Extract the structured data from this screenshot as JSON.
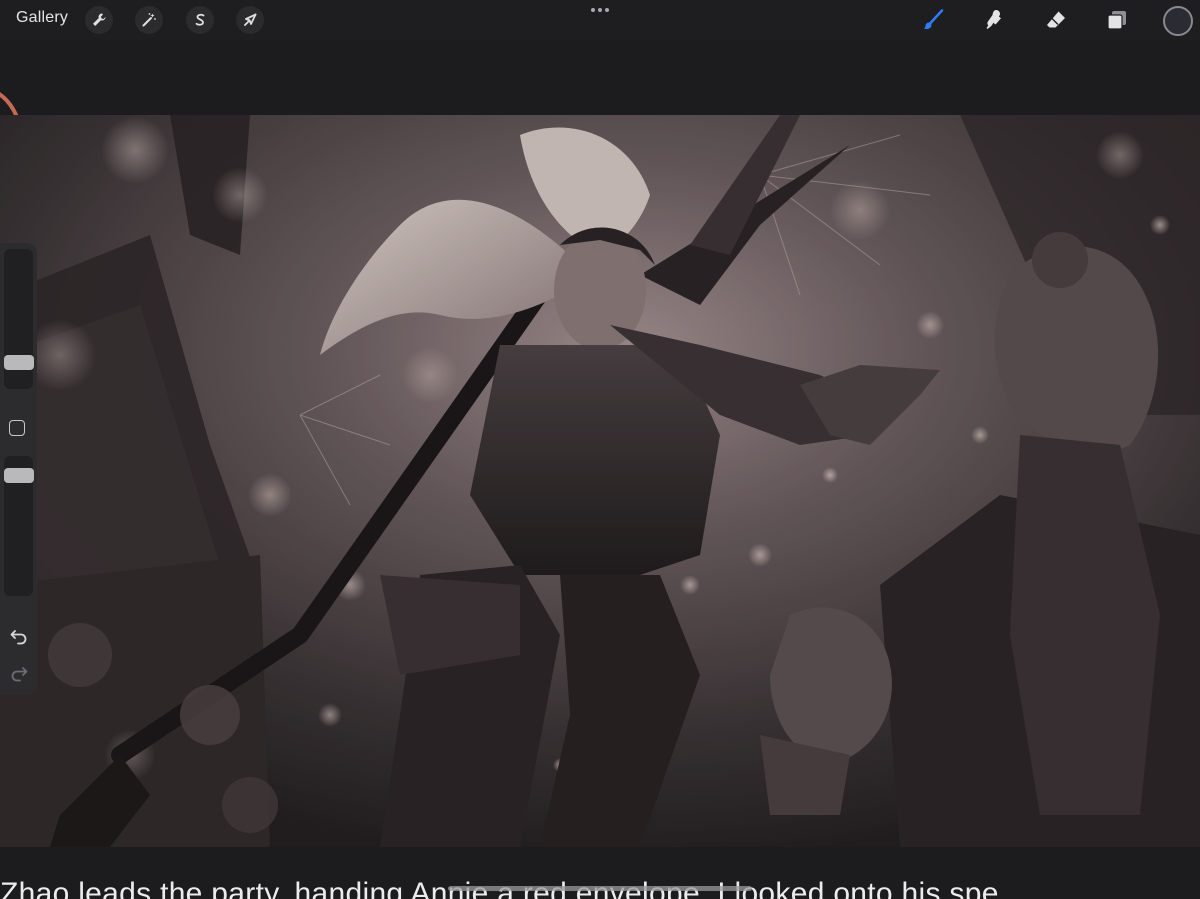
{
  "toolbar": {
    "gallery_label": "Gallery",
    "left_tools": [
      {
        "name": "actions",
        "icon": "wrench-icon"
      },
      {
        "name": "adjustments",
        "icon": "magic-wand-icon"
      },
      {
        "name": "selection",
        "icon": "selection-s-icon"
      },
      {
        "name": "transform",
        "icon": "arrow-cursor-icon"
      }
    ],
    "more_icon": "ellipsis-icon",
    "right_tools": [
      {
        "name": "brush",
        "icon": "brush-icon",
        "active": true
      },
      {
        "name": "smudge",
        "icon": "smudge-icon",
        "active": false
      },
      {
        "name": "eraser",
        "icon": "eraser-icon",
        "active": false
      },
      {
        "name": "layers",
        "icon": "layers-icon",
        "active": false
      }
    ],
    "current_color": "#2a2b33",
    "active_color": "#2f7bf6"
  },
  "sidebar": {
    "brush_size_level": 0.17,
    "opacity_level": 0.2,
    "modify_icon": "square-icon",
    "undo_icon": "undo-icon",
    "redo_icon": "redo-icon"
  },
  "canvas": {
    "artwork": "sepia-sketch-illustration"
  },
  "caption": {
    "text": "Zhao leads the party, handing Annie a red envelope. I looked onto his spe"
  }
}
